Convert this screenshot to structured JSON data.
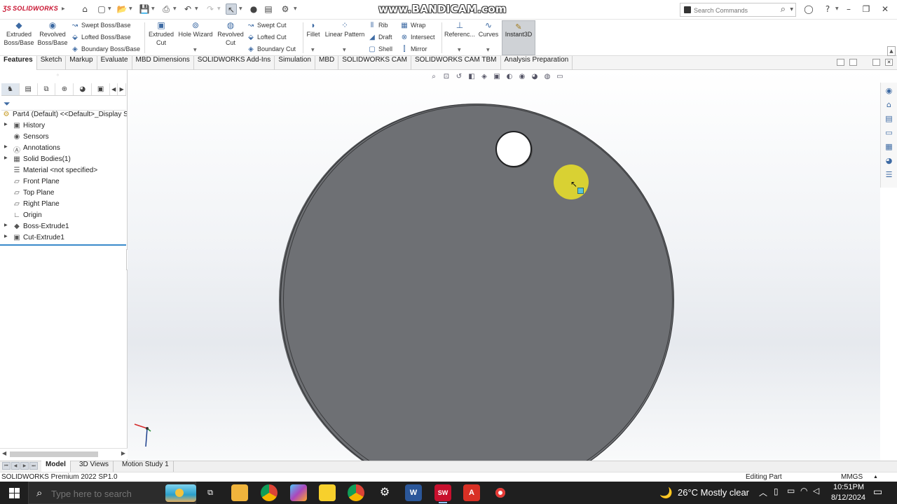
{
  "app": {
    "logo_text": "SOLIDWORKS",
    "watermark": "www.BANDICAM.com"
  },
  "search": {
    "placeholder": "Search Commands"
  },
  "ribbon": {
    "extruded_boss": "Extruded Boss/Base",
    "revolved_boss": "Revolved Boss/Base",
    "swept_boss": "Swept Boss/Base",
    "lofted_boss": "Lofted Boss/Base",
    "boundary_boss": "Boundary Boss/Base",
    "extruded_cut": "Extruded Cut",
    "hole_wizard": "Hole Wizard",
    "revolved_cut": "Revolved Cut",
    "swept_cut": "Swept Cut",
    "lofted_cut": "Lofted Cut",
    "boundary_cut": "Boundary Cut",
    "fillet": "Fillet",
    "linear_pattern": "Linear Pattern",
    "rib": "Rib",
    "draft": "Draft",
    "shell": "Shell",
    "wrap": "Wrap",
    "intersect": "Intersect",
    "mirror": "Mirror",
    "reference": "Referenc...",
    "curves": "Curves",
    "instant3d": "Instant3D"
  },
  "tabs": [
    "Features",
    "Sketch",
    "Markup",
    "Evaluate",
    "MBD Dimensions",
    "SOLIDWORKS Add-Ins",
    "Simulation",
    "MBD",
    "SOLIDWORKS CAM",
    "SOLIDWORKS CAM TBM",
    "Analysis Preparation"
  ],
  "tree": {
    "root": "Part4 (Default) <<Default>_Display S",
    "items": [
      "History",
      "Sensors",
      "Annotations",
      "Solid Bodies(1)",
      "Material <not specified>",
      "Front Plane",
      "Top Plane",
      "Right Plane",
      "Origin",
      "Boss-Extrude1",
      "Cut-Extrude1"
    ]
  },
  "bottom_tabs": [
    "Model",
    "3D Views",
    "Motion Study 1"
  ],
  "status": {
    "product": "SOLIDWORKS Premium 2022 SP1.0",
    "mode": "Editing Part",
    "units": "MMGS"
  },
  "taskbar": {
    "search_placeholder": "Type here to search",
    "weather": "26°C  Mostly clear",
    "time": "10:51PM",
    "date": "8/12/2024",
    "apps": [
      "Task View",
      "File Explorer",
      "Chrome",
      "Copilot",
      "Sticky Notes",
      "Chrome",
      "Settings",
      "Word",
      "SolidWorks",
      "Acrobat",
      "Record"
    ]
  },
  "colors": {
    "accent": "#3d6aa3",
    "part_face": "#6e7074",
    "cursor_highlight": "#ece228",
    "taskbar": "#1f1f1f"
  }
}
